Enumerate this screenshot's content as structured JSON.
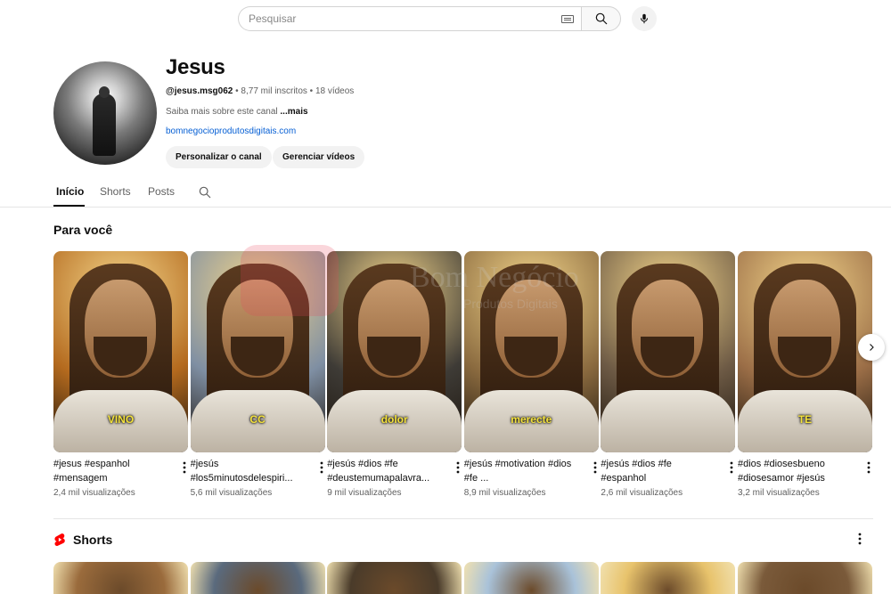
{
  "search": {
    "placeholder": "Pesquisar"
  },
  "channel": {
    "name": "Jesus",
    "handle": "@jesus.msg062",
    "stats": " • 8,77 mil inscritos • 18 vídeos",
    "about": "Saiba mais sobre este canal ",
    "about_more": "...mais",
    "link": "bomnegocioprodutosdigitais.com",
    "customize_label": "Personalizar o canal",
    "manage_label": "Gerenciar vídeos"
  },
  "tabs": [
    {
      "label": "Início",
      "active": true
    },
    {
      "label": "Shorts",
      "active": false
    },
    {
      "label": "Posts",
      "active": false
    }
  ],
  "for_you": {
    "title": "Para você",
    "cards": [
      {
        "caption": "VINO",
        "title": "#jesus #espanhol #mensagem",
        "views": "2,4 mil visualizações",
        "bg": "#b46a1e"
      },
      {
        "caption": "CC",
        "title": "#jesús #los5minutosdelespiri...",
        "views": "5,6 mil visualizações",
        "bg": "#7f8fa3"
      },
      {
        "caption": "dolor",
        "title": "#jesús #dios #fe #deustemumapalavra...",
        "views": "9 mil visualizações",
        "bg": "#3e3b36"
      },
      {
        "caption": "merecte",
        "title": "#jesús #motivation #dios #fe ...",
        "views": "8,9 mil visualizações",
        "bg": "#8a6a3f"
      },
      {
        "caption": "",
        "title": "#jesús #dios #fe #espanhol",
        "views": "2,6 mil visualizações",
        "bg": "#6d5a45"
      },
      {
        "caption": "TE",
        "title": "#dios #diosesbueno #diosesamor #jesús",
        "views": "3,2 mil visualizações",
        "bg": "#9b6e47"
      }
    ]
  },
  "shorts_section": {
    "title": "Shorts"
  },
  "watermark": {
    "text": "Bom Negócio",
    "sub": "Produtos Digitais"
  },
  "colors": {
    "accent_red": "#ff0000",
    "link_blue": "#065fd4",
    "caption_yellow": "#f4e23c"
  }
}
